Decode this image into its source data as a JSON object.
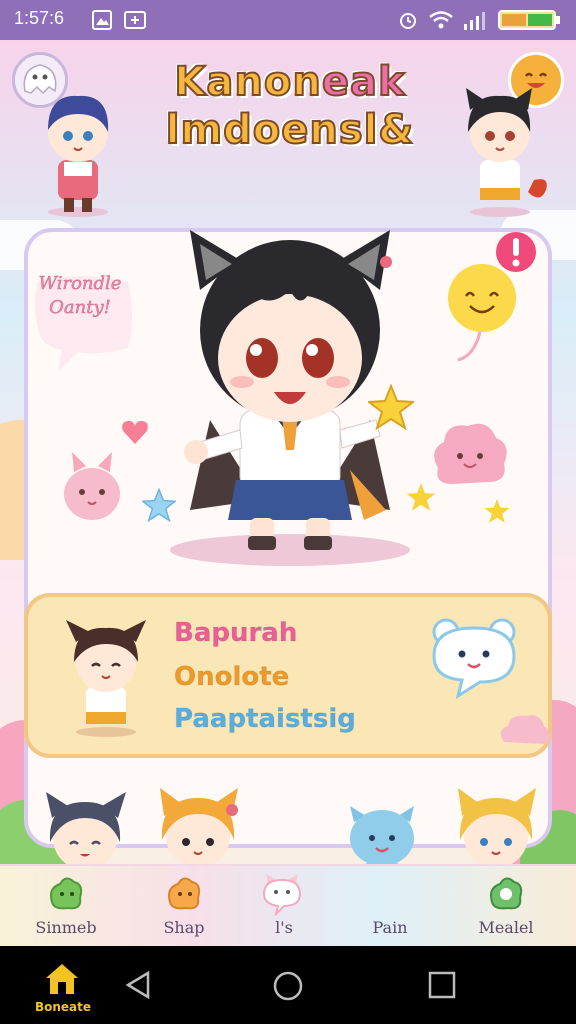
{
  "status_bar": {
    "time": "1:57:6",
    "icons": [
      "gallery-notification-icon",
      "screen-cast-icon",
      "alarm-icon",
      "wifi-icon",
      "signal-icon",
      "battery-icon"
    ],
    "color": "#8e6fb8"
  },
  "header": {
    "title_line1_a": "Kanon",
    "title_line1_b": "eak",
    "title_line2": "lmdoensl&",
    "left_button_icon": "ghost-face-icon",
    "right_button_icon": "smiley-face-icon"
  },
  "main_card": {
    "speech_bubble_text": "Wirondle Oanty!",
    "mascot": "cat-ear-girl-character",
    "accent_color": "#d9c8ef"
  },
  "info_card": {
    "line1": "Bapurah",
    "line2": "Onolote",
    "line3": "Paaptaistsig",
    "line1_color": "#e95f98",
    "line2_color": "#ec9a2a",
    "line3_color": "#5aaedf"
  },
  "bottom_nav": {
    "items": [
      {
        "label": "Sinmeb",
        "icon": "green-blob-icon"
      },
      {
        "label": "Shap",
        "icon": "orange-blob-icon"
      },
      {
        "label": "l's",
        "icon": "white-cat-bubble-icon"
      },
      {
        "label": "Pain",
        "icon": "blue-bear-icon"
      },
      {
        "label": "Mealel",
        "icon": "green-badge-icon"
      }
    ]
  },
  "system_nav": {
    "home_label": "Boneate",
    "buttons": [
      "back-icon",
      "home-icon",
      "recents-icon"
    ]
  }
}
